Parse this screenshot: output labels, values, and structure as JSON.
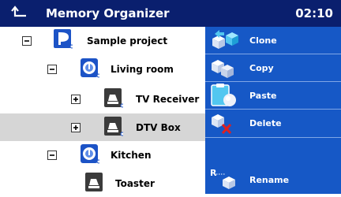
{
  "header": {
    "title": "Memory Organizer",
    "time": "02:10"
  },
  "tree": {
    "sample_project": "Sample project",
    "living_room": "Living room",
    "tv_receiver": "TV Receiver",
    "dtv_box": "DTV Box",
    "kitchen": "Kitchen",
    "toaster": "Toaster"
  },
  "sidebar": {
    "clone": "Clone",
    "copy": "Copy",
    "paste": "Paste",
    "delete": "Delete",
    "rename": "Rename",
    "rename_icon_letter": "R"
  },
  "colors": {
    "header_bg": "#0a1f6e",
    "sidebar_bg": "#1658c6",
    "selected_row": "#d6d6d6",
    "delete_x": "#e02020"
  }
}
